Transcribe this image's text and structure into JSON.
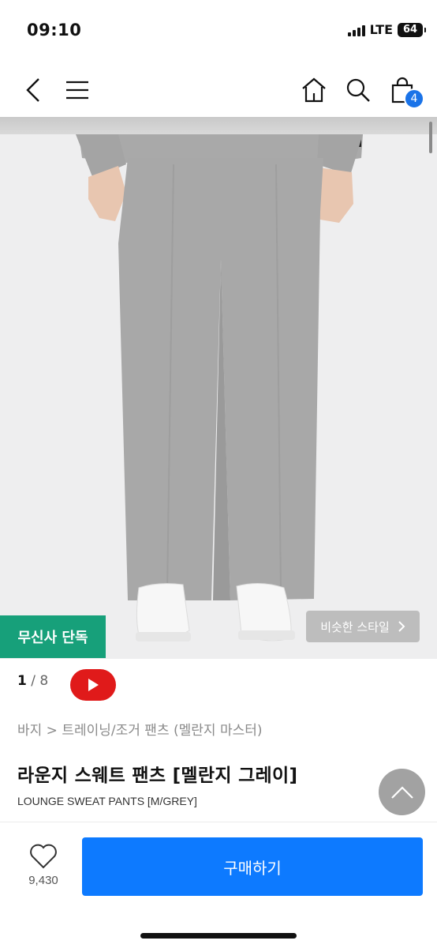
{
  "status_bar": {
    "time": "09:10",
    "network": "LTE",
    "battery": "64"
  },
  "nav": {
    "icons": [
      "back-icon",
      "menu-icon",
      "home-icon",
      "search-icon",
      "cart-icon"
    ],
    "cart_count": "4"
  },
  "hero": {
    "exclusive_label": "무신사 단독",
    "similar_style_label": "비슷한 스타일"
  },
  "pager": {
    "current": "1",
    "separator": " / ",
    "total": "8"
  },
  "breadcrumb": "바지 > 트레이닝/조거 팬츠 (멜란지 마스터)",
  "product": {
    "title": "라운지 스웨트 팬츠 [멜란지 그레이]",
    "subtitle": "LOUNGE SWEAT PANTS [M/GREY]"
  },
  "bottom_bar": {
    "like_count": "9,430",
    "buy_label": "구매하기"
  },
  "colors": {
    "accent": "#0d7aff",
    "badge": "#17a07a",
    "youtube": "#e01a1a"
  }
}
